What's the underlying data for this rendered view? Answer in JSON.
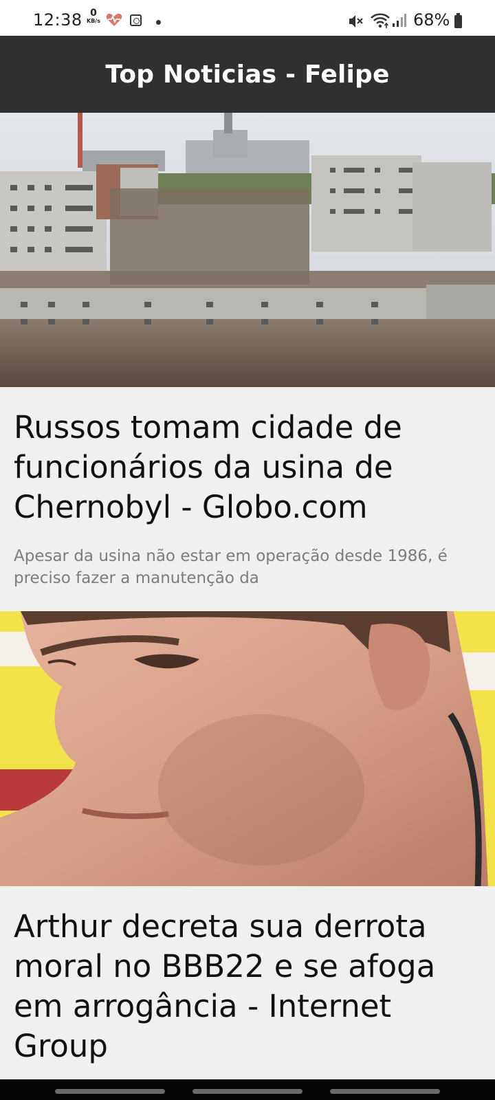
{
  "status_bar": {
    "time": "12:38",
    "net_speed_value": "0",
    "net_speed_unit": "KB/s",
    "icons": [
      "heart-monitor-icon",
      "app-clock-icon",
      "notification-dot-icon",
      "mute-icon",
      "wifi-icon",
      "signal-icon",
      "battery-icon"
    ],
    "battery": "68%"
  },
  "app_bar": {
    "title": "Top Noticias - Felipe"
  },
  "articles": [
    {
      "image": "chernobyl-city-photo",
      "headline": "Russos tomam cidade de funcionários da usina de Chernobyl - Globo.com",
      "summary": "Apesar da usina não estar em operação desde 1986, é preciso fazer a manutenção da"
    },
    {
      "image": "person-face-closeup-photo",
      "headline": "Arthur decreta sua derrota moral no BBB22 e se afoga em arrogância - Internet Group"
    }
  ],
  "colors": {
    "app_bar": "#303030",
    "background": "#f0f0f0",
    "headline": "#111111",
    "summary": "#7c7c7c"
  }
}
